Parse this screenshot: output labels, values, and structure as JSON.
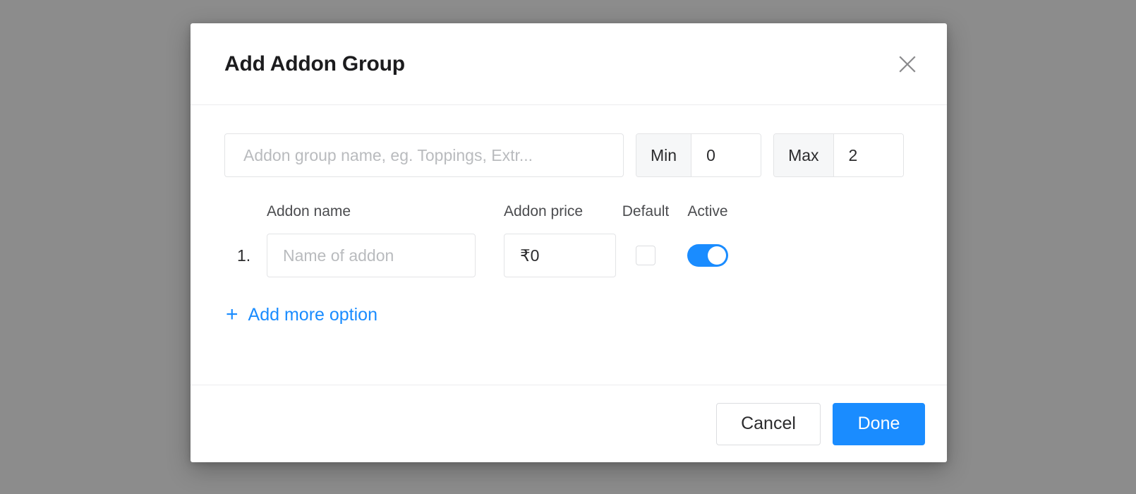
{
  "backdrop": {
    "color": "#8c8c8c"
  },
  "theme": {
    "accent": "#1a8cff",
    "border": "#e3e4e6",
    "divider": "#ececee",
    "text": "#2b2b2d",
    "placeholder": "#b9bbbe"
  },
  "modal": {
    "title": "Add Addon Group",
    "close_icon": "close-icon"
  },
  "form": {
    "group_name": {
      "value": "",
      "placeholder": "Addon group name, eg. Toppings, Extr..."
    },
    "min": {
      "label": "Min",
      "value": "0"
    },
    "max": {
      "label": "Max",
      "value": "2"
    }
  },
  "table": {
    "headers": {
      "name": "Addon name",
      "price": "Addon price",
      "default": "Default",
      "active": "Active"
    },
    "rows": [
      {
        "index": "1.",
        "name_value": "",
        "name_placeholder": "Name of addon",
        "price_value": "₹0",
        "default_checked": false,
        "active_on": true
      }
    ]
  },
  "add_more": {
    "icon": "plus-icon",
    "plus": "+",
    "label": "Add more option"
  },
  "footer": {
    "cancel_label": "Cancel",
    "done_label": "Done"
  }
}
